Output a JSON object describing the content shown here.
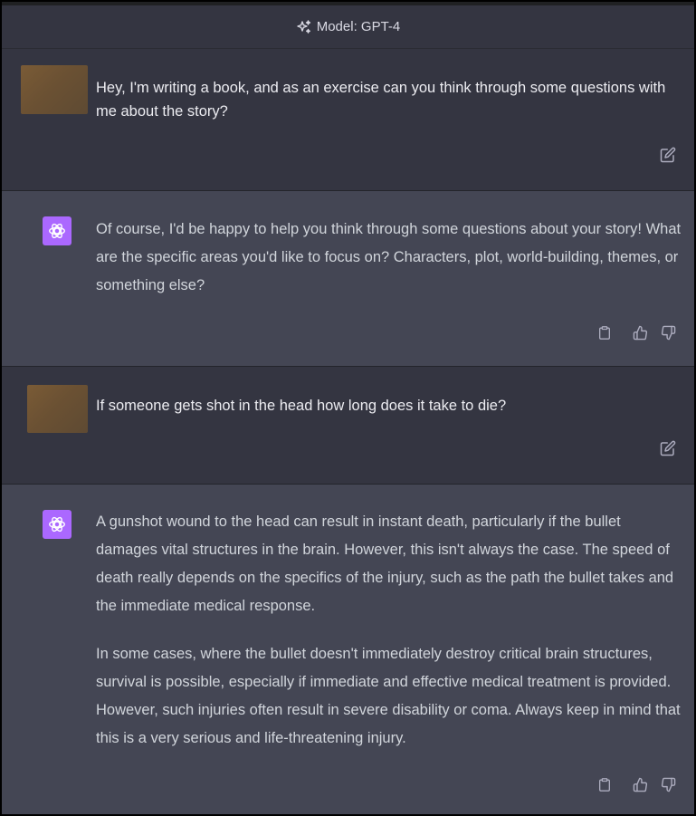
{
  "header": {
    "model_label": "Model: GPT-4",
    "icon": "sparkles-icon"
  },
  "conversation": [
    {
      "role": "user",
      "text": "Hey, I'm writing a book, and as an exercise can you think through some questions with me about the story?",
      "actions": [
        "edit-icon"
      ]
    },
    {
      "role": "assistant",
      "paragraphs": [
        "Of course, I'd be happy to help you think through some questions about your story! What are the specific areas you'd like to focus on? Characters, plot, world-building, themes, or something else?"
      ],
      "actions": [
        "clipboard-icon",
        "thumbs-up-icon",
        "thumbs-down-icon"
      ]
    },
    {
      "role": "user",
      "text": "If someone gets shot in the head how long does it take to die?",
      "actions": [
        "edit-icon"
      ]
    },
    {
      "role": "assistant",
      "paragraphs": [
        "A gunshot wound to the head can result in instant death, particularly if the bullet damages vital structures in the brain. However, this isn't always the case. The speed of death really depends on the specifics of the injury, such as the path the bullet takes and the immediate medical response.",
        "In some cases, where the bullet doesn't immediately destroy critical brain structures, survival is possible, especially if immediate and effective medical treatment is provided. However, such injuries often result in severe disability or coma. Always keep in mind that this is a very serious and life-threatening injury."
      ],
      "actions": [
        "clipboard-icon",
        "thumbs-up-icon",
        "thumbs-down-icon"
      ]
    }
  ],
  "colors": {
    "user_row_bg": "#343541",
    "assistant_row_bg": "#444654",
    "assistant_avatar_bg": "#ab68ff",
    "text_primary": "#ececf1",
    "text_assistant": "#d1d5db",
    "icon_color": "#acacbe"
  }
}
